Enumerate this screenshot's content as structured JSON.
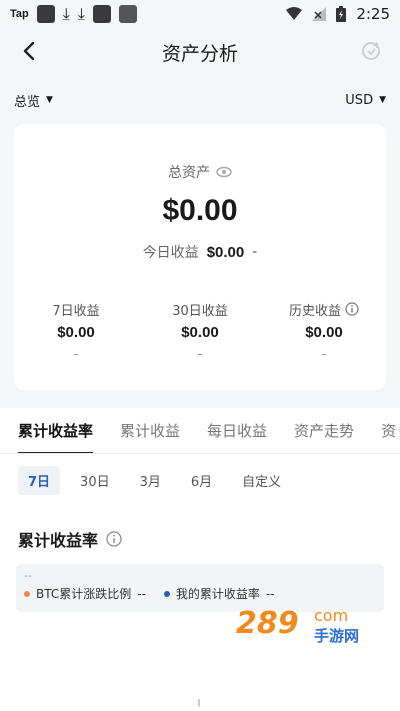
{
  "status": {
    "left_text": "Tap",
    "time": "2:25"
  },
  "header": {
    "title": "资产分析"
  },
  "filters": {
    "scope": "总览",
    "currency": "USD"
  },
  "summary": {
    "total_label": "总资产",
    "total_value": "$0.00",
    "today_label": "今日收益",
    "today_value": "$0.00",
    "today_change": "-",
    "stats": [
      {
        "label": "7日收益",
        "value": "$0.00",
        "change": "-"
      },
      {
        "label": "30日收益",
        "value": "$0.00",
        "change": "-"
      },
      {
        "label": "历史收益",
        "value": "$0.00",
        "change": "-"
      }
    ]
  },
  "tabs": [
    "累计收益率",
    "累计收益",
    "每日收益",
    "资产走势",
    "资"
  ],
  "periods": [
    "7日",
    "30日",
    "3月",
    "6月",
    "自定义"
  ],
  "section": {
    "title": "累计收益率"
  },
  "legend": {
    "top": "--",
    "items": [
      {
        "label": "BTC累计涨跌比例",
        "value": "--",
        "color": "#e38b4a"
      },
      {
        "label": "我的累计收益率",
        "value": "--",
        "color": "#2a5fb8"
      }
    ]
  },
  "watermark": {
    "text": "289 com 手游网"
  },
  "colors": {
    "accent": "#2a5fb8",
    "orange": "#f08a1c"
  }
}
